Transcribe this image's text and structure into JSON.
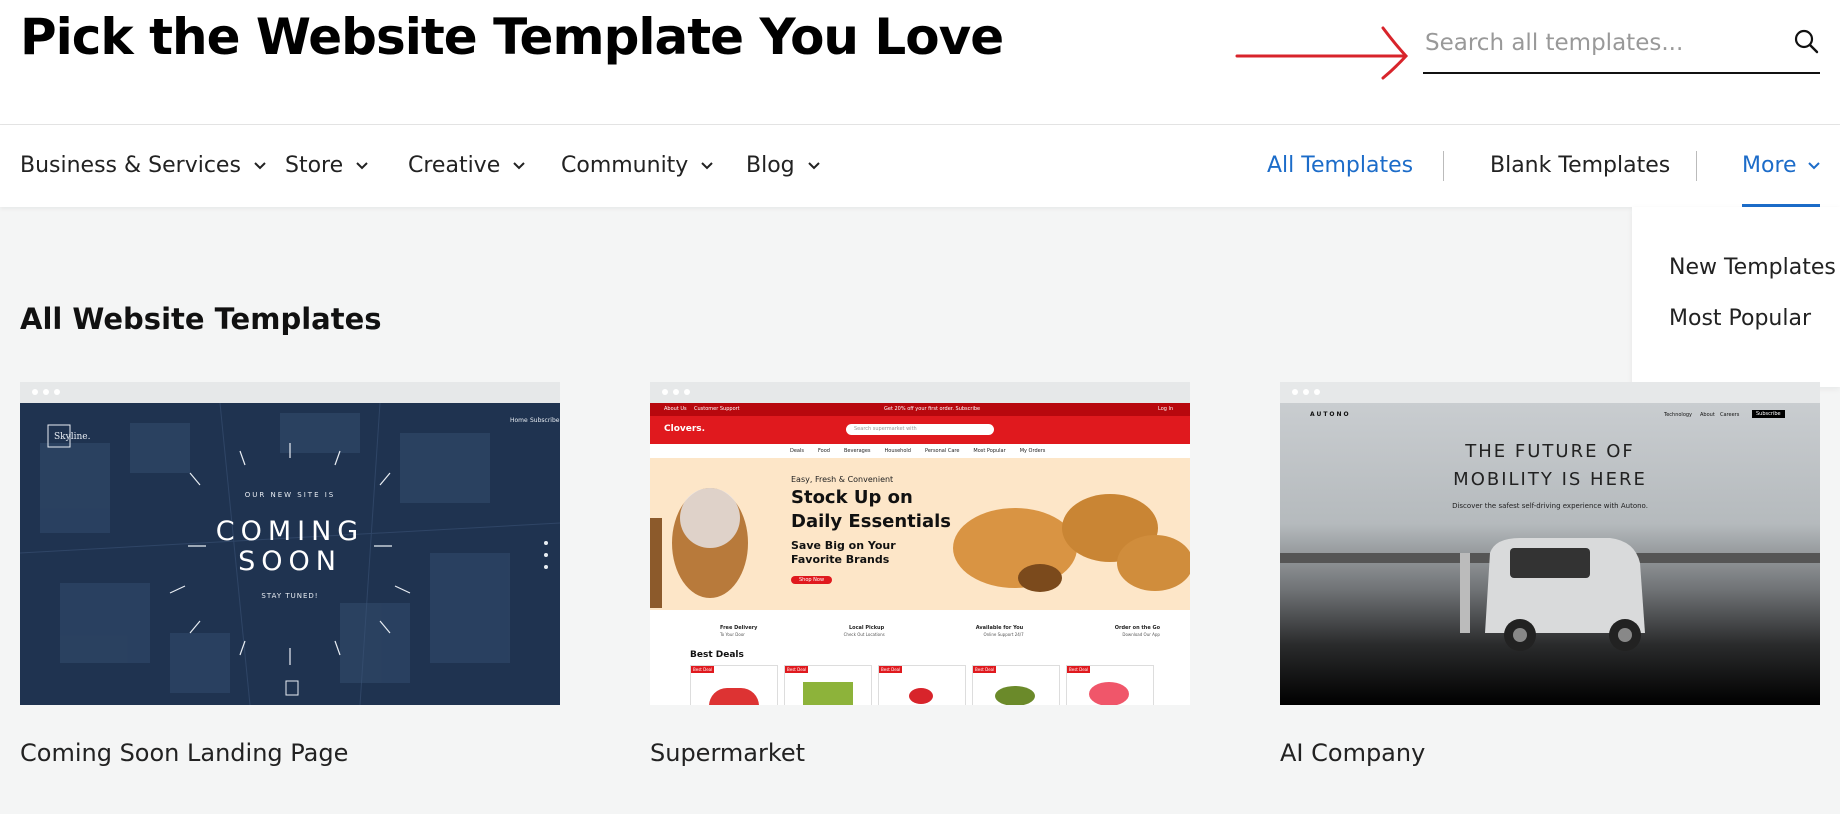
{
  "header": {
    "title": "Pick the Website Template You Love",
    "search_placeholder": "Search all templates..."
  },
  "nav": {
    "categories": [
      "Business & Services",
      "Store",
      "Creative",
      "Community",
      "Blog"
    ],
    "all_templates": "All Templates",
    "blank_templates": "Blank Templates",
    "more": "More"
  },
  "more_menu": {
    "items": [
      "New Templates",
      "Most Popular"
    ]
  },
  "section": {
    "title": "All Website Templates"
  },
  "templates": [
    {
      "name": "Coming Soon Landing Page",
      "preview": {
        "logo": "Skyline.",
        "nav": [
          "Home",
          "Subscribe"
        ],
        "kicker": "OUR NEW SITE IS",
        "headline1": "COMING",
        "headline2": "SOON",
        "tagline": "STAY TUNED!"
      }
    },
    {
      "name": "Supermarket",
      "preview": {
        "topbar_left": [
          "About Us",
          "Customer Support"
        ],
        "promo": "Get 20% off your first order. Subscribe",
        "login": "Log In",
        "brand": "Clovers.",
        "search": "Search supermarket with",
        "menu": [
          "Deals",
          "Food",
          "Beverages",
          "Household",
          "Personal Care",
          "Most Popular",
          "My Orders"
        ],
        "hero_kicker": "Easy, Fresh & Convenient",
        "hero_title1": "Stock Up on",
        "hero_title2": "Daily Essentials",
        "hero_sub1": "Save Big on Your",
        "hero_sub2": "Favorite Brands",
        "hero_cta": "Shop Now",
        "features": [
          "Free Delivery",
          "Local Pickup",
          "Available for You",
          "Order on the Go"
        ],
        "feature_subs": [
          "To Your Door",
          "Check Out Locations",
          "Online Support 24/7",
          "Download Our App"
        ],
        "deals_title": "Best Deals",
        "deal_badge": "Best Deal"
      }
    },
    {
      "name": "AI Company",
      "preview": {
        "brand": "AUTONO",
        "nav": [
          "Technology",
          "About",
          "Careers",
          "Subscribe"
        ],
        "headline1": "THE FUTURE OF",
        "headline2": "MOBILITY IS HERE",
        "sub": "Discover the safest self-driving experience with Autono."
      }
    }
  ],
  "colors": {
    "accent_blue": "#1c6cc9",
    "arrow_red": "#d8242b",
    "page_bg": "#f4f5f5",
    "market_red": "#e0191e"
  }
}
